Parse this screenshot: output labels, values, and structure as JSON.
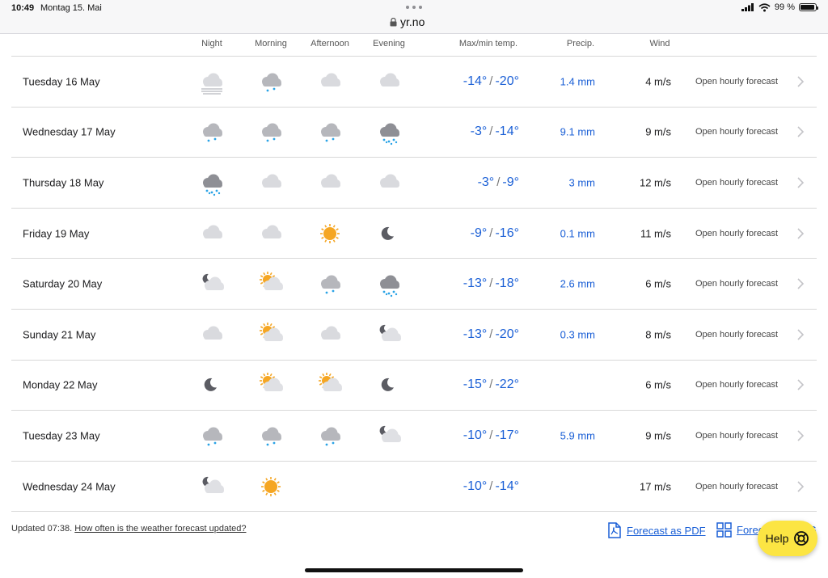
{
  "status": {
    "time": "10:49",
    "date": "Montag 15. Mai",
    "url": "yr.no",
    "battery": "99 %"
  },
  "columns": {
    "night": "Night",
    "morning": "Morning",
    "afternoon": "Afternoon",
    "evening": "Evening",
    "temp": "Max/min temp.",
    "precip": "Precip.",
    "wind": "Wind"
  },
  "rows": [
    {
      "day": "Tuesday 16 May",
      "icons": [
        "fog-icon",
        "cloud-light-snow-icon",
        "cloud-icon",
        "cloud-icon"
      ],
      "max": "-14°",
      "min": "-20°",
      "precip": "1.4 mm",
      "wind": "4 m/s",
      "link": "Open hourly forecast"
    },
    {
      "day": "Wednesday 17 May",
      "icons": [
        "cloud-light-snow-icon",
        "cloud-light-snow-icon",
        "cloud-light-snow-icon",
        "cloud-heavy-snow-icon"
      ],
      "max": "-3°",
      "min": "-14°",
      "precip": "9.1 mm",
      "wind": "9 m/s",
      "link": "Open hourly forecast"
    },
    {
      "day": "Thursday 18 May",
      "icons": [
        "cloud-heavy-snow-icon",
        "cloud-icon",
        "cloud-icon",
        "cloud-icon"
      ],
      "max": "-3°",
      "min": "-9°",
      "precip": "3 mm",
      "wind": "12 m/s",
      "link": "Open hourly forecast"
    },
    {
      "day": "Friday 19 May",
      "icons": [
        "cloud-icon",
        "cloud-icon",
        "sun-icon",
        "moon-icon"
      ],
      "max": "-9°",
      "min": "-16°",
      "precip": "0.1 mm",
      "wind": "11 m/s",
      "link": "Open hourly forecast"
    },
    {
      "day": "Saturday 20 May",
      "icons": [
        "moon-cloud-icon",
        "sun-cloud-icon",
        "cloud-light-snow-icon",
        "cloud-heavy-snow-icon"
      ],
      "max": "-13°",
      "min": "-18°",
      "precip": "2.6 mm",
      "wind": "6 m/s",
      "link": "Open hourly forecast"
    },
    {
      "day": "Sunday 21 May",
      "icons": [
        "cloud-icon",
        "sun-cloud-icon",
        "cloud-icon",
        "moon-cloud-icon"
      ],
      "max": "-13°",
      "min": "-20°",
      "precip": "0.3 mm",
      "wind": "8 m/s",
      "link": "Open hourly forecast"
    },
    {
      "day": "Monday 22 May",
      "icons": [
        "moon-icon",
        "sun-cloud-icon",
        "sun-cloud-icon",
        "moon-icon"
      ],
      "max": "-15°",
      "min": "-22°",
      "precip": "",
      "wind": "6 m/s",
      "link": "Open hourly forecast"
    },
    {
      "day": "Tuesday 23 May",
      "icons": [
        "cloud-light-snow-icon",
        "cloud-light-snow-icon",
        "cloud-light-snow-icon",
        "moon-cloud-icon"
      ],
      "max": "-10°",
      "min": "-17°",
      "precip": "5.9 mm",
      "wind": "9 m/s",
      "link": "Open hourly forecast"
    },
    {
      "day": "Wednesday 24 May",
      "icons": [
        "moon-cloud-icon",
        "sun-icon",
        "",
        ""
      ],
      "max": "-10°",
      "min": "-14°",
      "precip": "",
      "wind": "17 m/s",
      "link": "Open hourly forecast"
    }
  ],
  "footer": {
    "updated": "Updated 07:38.",
    "how_often": "How often is the weather forecast updated?",
    "pdf": "Forecast as PDF",
    "print": "Forecast as SVG",
    "help": "Help"
  },
  "colors": {
    "link": "#1a5fd6",
    "help": "#fce543",
    "snow": "#2aa3e6",
    "sun": "#f5a623"
  }
}
